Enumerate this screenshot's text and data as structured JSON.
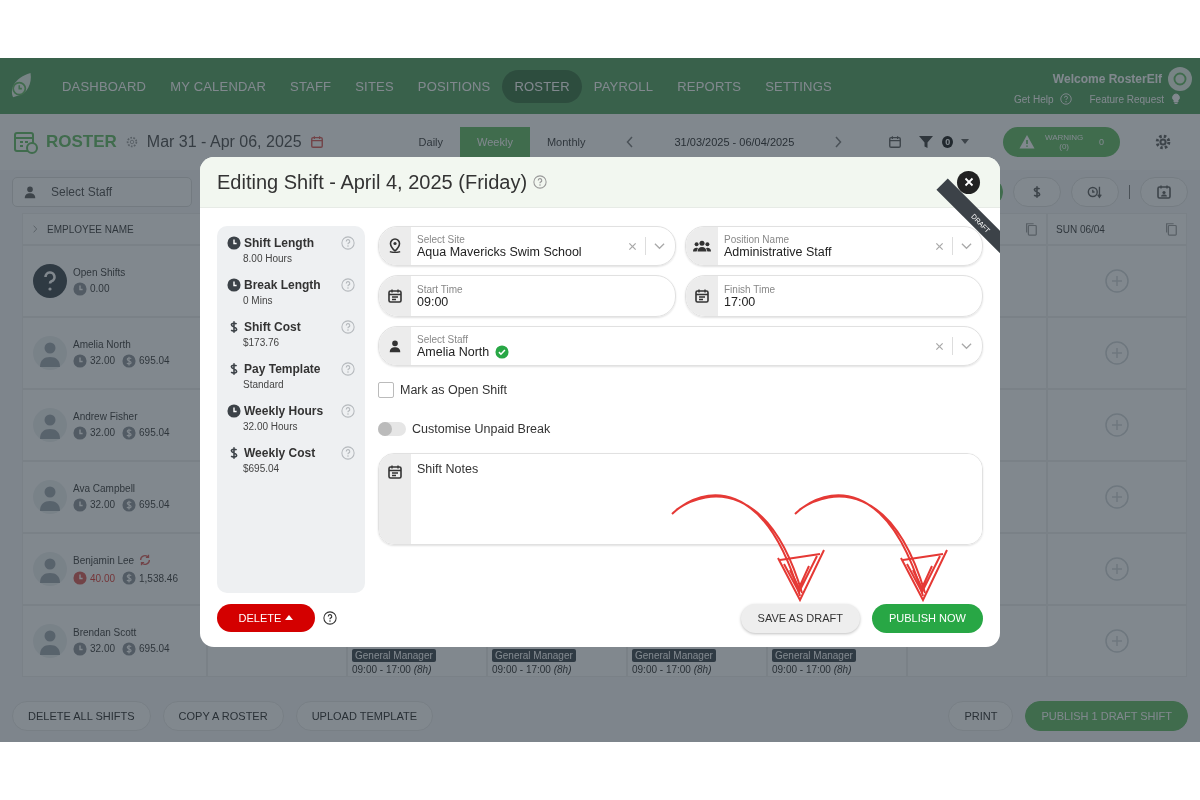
{
  "nav": {
    "items": [
      {
        "label": "DASHBOARD",
        "selected": false
      },
      {
        "label": "MY CALENDAR",
        "selected": false
      },
      {
        "label": "STAFF",
        "selected": false
      },
      {
        "label": "SITES",
        "selected": false
      },
      {
        "label": "POSITIONS",
        "selected": false
      },
      {
        "label": "ROSTER",
        "selected": true
      },
      {
        "label": "PAYROLL",
        "selected": false
      },
      {
        "label": "REPORTS",
        "selected": false
      },
      {
        "label": "SETTINGS",
        "selected": false
      }
    ],
    "welcome": "Welcome RosterElf",
    "help": "Get Help",
    "feature": "Feature Request"
  },
  "roster_header": {
    "title": "ROSTER",
    "date_range": "Mar 31 - Apr 06, 2025",
    "views": [
      {
        "label": "Daily",
        "selected": false
      },
      {
        "label": "Weekly",
        "selected": true
      },
      {
        "label": "Monthly",
        "selected": false
      }
    ],
    "range_field": "31/03/2025 - 06/04/2025",
    "filter_count": "0",
    "warning_label": "WARNING (0)",
    "warning_count": "0"
  },
  "toolbar": {
    "staff_placeholder": "Select Staff"
  },
  "grid": {
    "employee_header": "EMPLOYEE NAME",
    "day_header": "SUN 06/04",
    "rows": [
      {
        "kind": "open",
        "name": "Open Shifts",
        "hours": "0.00",
        "over_hours": false,
        "flagged": false,
        "cells": [
          {
            "kind": "empty"
          },
          {
            "kind": "empty"
          },
          {
            "kind": "empty"
          },
          {
            "kind": "empty"
          },
          {
            "kind": "empty"
          },
          {
            "kind": "empty"
          },
          {
            "kind": "add"
          }
        ]
      },
      {
        "kind": "employee",
        "name": "Amelia North",
        "hours": "32.00",
        "cost": "695.04",
        "over_hours": false,
        "flagged": false,
        "cells": [
          {
            "kind": "empty"
          },
          {
            "kind": "empty"
          },
          {
            "kind": "empty"
          },
          {
            "kind": "empty"
          },
          {
            "kind": "empty"
          },
          {
            "kind": "empty"
          },
          {
            "kind": "add"
          }
        ]
      },
      {
        "kind": "employee",
        "name": "Andrew Fisher",
        "hours": "32.00",
        "cost": "695.04",
        "over_hours": false,
        "flagged": false,
        "cells": [
          {
            "kind": "empty"
          },
          {
            "kind": "empty"
          },
          {
            "kind": "empty"
          },
          {
            "kind": "empty"
          },
          {
            "kind": "empty"
          },
          {
            "kind": "empty"
          },
          {
            "kind": "add"
          }
        ]
      },
      {
        "kind": "employee",
        "name": "Ava Campbell",
        "hours": "32.00",
        "cost": "695.04",
        "over_hours": false,
        "flagged": false,
        "cells": [
          {
            "kind": "empty"
          },
          {
            "kind": "empty"
          },
          {
            "kind": "empty"
          },
          {
            "kind": "empty"
          },
          {
            "kind": "empty"
          },
          {
            "kind": "empty"
          },
          {
            "kind": "add"
          }
        ]
      },
      {
        "kind": "employee",
        "name": "Benjamin Lee",
        "hours": "40.00",
        "cost": "1,538.46",
        "over_hours": true,
        "flagged": true,
        "cells": [
          {
            "kind": "empty"
          },
          {
            "kind": "empty"
          },
          {
            "kind": "empty"
          },
          {
            "kind": "empty"
          },
          {
            "kind": "empty"
          },
          {
            "kind": "empty"
          },
          {
            "kind": "add"
          }
        ]
      },
      {
        "kind": "employee",
        "name": "Brendan Scott",
        "hours": "32.00",
        "cost": "695.04",
        "over_hours": false,
        "flagged": false,
        "cells": [
          {
            "kind": "empty"
          },
          {
            "kind": "shift",
            "position": "General Manager",
            "time": "09:00 - 17:00 *(8h)*"
          },
          {
            "kind": "shift",
            "position": "General Manager",
            "time": "09:00 - 17:00 *(8h)*"
          },
          {
            "kind": "shift",
            "position": "General Manager",
            "time": "09:00 - 17:00 *(8h)*"
          },
          {
            "kind": "shift",
            "position": "General Manager",
            "time": "09:00 - 17:00 *(8h)*"
          },
          {
            "kind": "empty"
          },
          {
            "kind": "add"
          }
        ]
      }
    ]
  },
  "bottom_bar": {
    "left_buttons": [
      "DELETE ALL SHIFTS",
      "COPY A ROSTER",
      "UPLOAD TEMPLATE"
    ],
    "print": "PRINT",
    "publish": "PUBLISH 1 DRAFT SHIFT"
  },
  "modal": {
    "title": "Editing Shift - April 4, 2025 (Friday)",
    "ribbon": "DRAFT",
    "stats": [
      {
        "kind": "time",
        "label": "Shift Length",
        "value": "8.00 Hours"
      },
      {
        "kind": "time",
        "label": "Break Length",
        "value": "0 Mins"
      },
      {
        "kind": "money",
        "label": "Shift Cost",
        "value": "$173.76"
      },
      {
        "kind": "money",
        "label": "Pay Template",
        "value": "Standard"
      },
      {
        "kind": "time",
        "label": "Weekly Hours",
        "value": "32.00 Hours"
      },
      {
        "kind": "money",
        "label": "Weekly Cost",
        "value": "$695.04"
      }
    ],
    "site": {
      "label": "Select Site",
      "value": "Aqua Mavericks Swim School"
    },
    "position": {
      "label": "Position Name",
      "value": "Administrative Staff"
    },
    "start": {
      "label": "Start Time",
      "value": "09:00"
    },
    "finish": {
      "label": "Finish Time",
      "value": "17:00"
    },
    "staff": {
      "label": "Select Staff",
      "value": "Amelia North",
      "verified": true
    },
    "open_shift": {
      "label": "Mark as Open Shift",
      "checked": false
    },
    "unpaid_break": {
      "label": "Customise Unpaid Break",
      "on": false
    },
    "notes": {
      "placeholder": "Shift Notes"
    },
    "delete": "DELETE",
    "save_draft": "SAVE AS DRAFT",
    "publish": "PUBLISH NOW"
  }
}
